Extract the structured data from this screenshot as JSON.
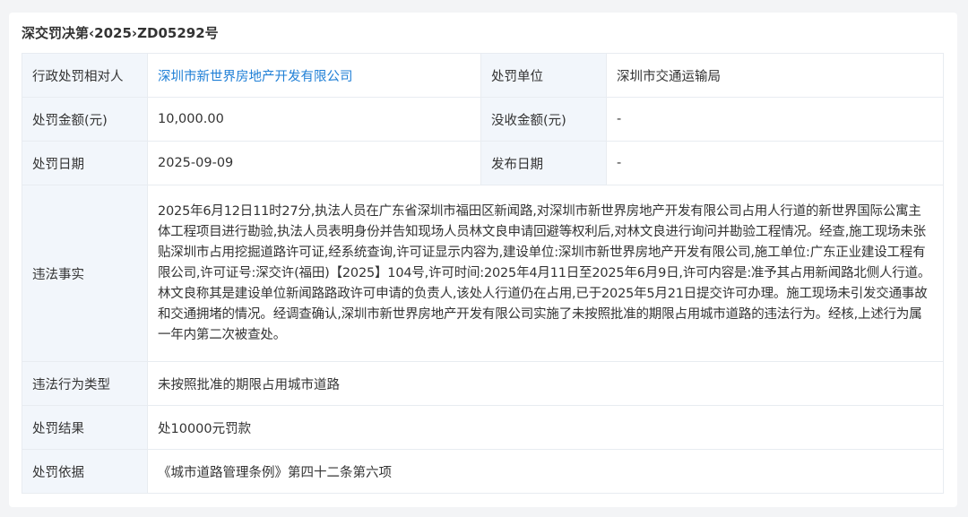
{
  "document": {
    "title": "深交罚决第‹2025›ZD05292号"
  },
  "rows": {
    "party": {
      "label": "行政处罚相对人",
      "value": "深圳市新世界房地产开发有限公司"
    },
    "unit": {
      "label": "处罚单位",
      "value": "深圳市交通运输局"
    },
    "amount": {
      "label": "处罚金额(元)",
      "value": "10,000.00"
    },
    "confiscation": {
      "label": "没收金额(元)",
      "value": "-"
    },
    "date": {
      "label": "处罚日期",
      "value": "2025-09-09"
    },
    "publish_date": {
      "label": "发布日期",
      "value": "-"
    },
    "facts": {
      "label": "违法事实",
      "value": "2025年6月12日11时27分,执法人员在广东省深圳市福田区新闻路,对深圳市新世界房地产开发有限公司占用人行道的新世界国际公寓主体工程项目进行勘验,执法人员表明身份并告知现场人员林文良申请回避等权利后,对林文良进行询问并勘验工程情况。经查,施工现场未张贴深圳市占用挖掘道路许可证,经系统查询,许可证显示内容为,建设单位:深圳市新世界房地产开发有限公司,施工单位:广东正业建设工程有限公司,许可证号:深交许(福田)【2025】104号,许可时间:2025年4月11日至2025年6月9日,许可内容是:准予其占用新闻路北侧人行道。林文良称其是建设单位新闻路路政许可申请的负责人,该处人行道仍在占用,已于2025年5月21日提交许可办理。施工现场未引发交通事故和交通拥堵的情况。经调查确认,深圳市新世界房地产开发有限公司实施了未按照批准的期限占用城市道路的违法行为。经核,上述行为属一年内第二次被查处。"
    },
    "violation_type": {
      "label": "违法行为类型",
      "value": "未按照批准的期限占用城市道路"
    },
    "result": {
      "label": "处罚结果",
      "value": "处10000元罚款"
    },
    "basis": {
      "label": "处罚依据",
      "value": "《城市道路管理条例》第四十二条第六项"
    }
  },
  "colors": {
    "label_bg": "#f2f6fb",
    "border": "#e8ecf1",
    "link": "#1f7fd6",
    "page_bg": "#f3f4f6"
  }
}
